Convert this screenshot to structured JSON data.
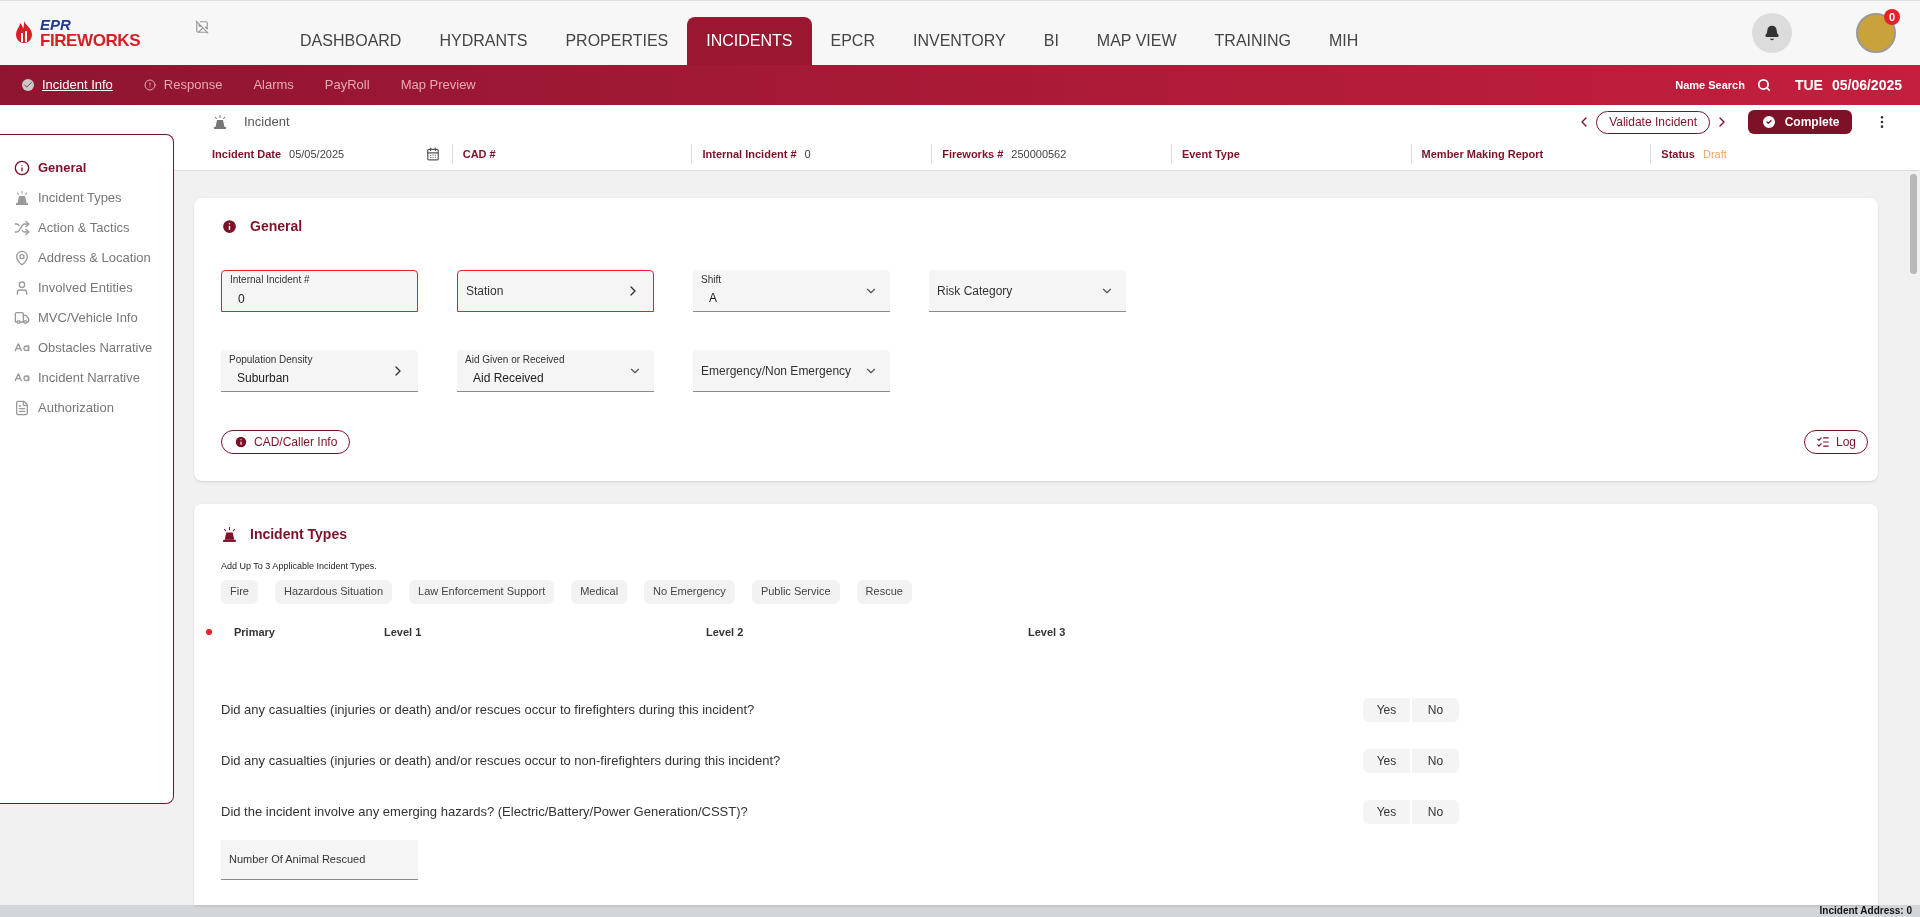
{
  "logo": {
    "top": "EPR",
    "bottom": "FIREWORKS"
  },
  "nav": [
    {
      "label": "DASHBOARD",
      "selected": false
    },
    {
      "label": "HYDRANTS",
      "selected": false
    },
    {
      "label": "PROPERTIES",
      "selected": false
    },
    {
      "label": "INCIDENTS",
      "selected": true
    },
    {
      "label": "EPCR",
      "selected": false
    },
    {
      "label": "INVENTORY",
      "selected": false
    },
    {
      "label": "BI",
      "selected": false
    },
    {
      "label": "MAP VIEW",
      "selected": false
    },
    {
      "label": "TRAINING",
      "selected": false
    },
    {
      "label": "MIH",
      "selected": false
    }
  ],
  "notification_badge": "0",
  "subnav": [
    {
      "label": "Incident Info",
      "selected": true,
      "kind": "check"
    },
    {
      "label": "Response",
      "selected": false,
      "kind": "alert"
    },
    {
      "label": "Alarms",
      "selected": false,
      "kind": "plain"
    },
    {
      "label": "PayRoll",
      "selected": false,
      "kind": "plain"
    },
    {
      "label": "Map Preview",
      "selected": false,
      "kind": "plain"
    }
  ],
  "name_search": "Name Search",
  "date": {
    "day": "TUE",
    "value": "05/06/2025"
  },
  "incident_header": {
    "title": "Incident",
    "validate": "Validate Incident",
    "complete": "Complete",
    "fields": [
      {
        "label": "Incident Date",
        "value": "05/05/2025",
        "kind": "date"
      },
      {
        "label": "CAD #",
        "kind": "text"
      },
      {
        "label": "Internal Incident #",
        "value": "0",
        "kind": "text"
      },
      {
        "label": "Fireworks #",
        "value": "250000562",
        "kind": "text"
      },
      {
        "label": "Event Type",
        "kind": "text"
      },
      {
        "label": "Member Making Report",
        "kind": "text"
      },
      {
        "label": "Status",
        "value": "Draft",
        "kind": "status"
      }
    ]
  },
  "sidebar": [
    {
      "label": "General",
      "selected": true,
      "kind": "info"
    },
    {
      "label": "Incident Types",
      "selected": false,
      "kind": "siren"
    },
    {
      "label": "Action & Tactics",
      "selected": false,
      "kind": "tactics"
    },
    {
      "label": "Address & Location",
      "selected": false,
      "kind": "pin"
    },
    {
      "label": "Involved Entities",
      "selected": false,
      "kind": "person"
    },
    {
      "label": "MVC/Vehicle Info",
      "selected": false,
      "kind": "vehicle"
    },
    {
      "label": "Obstacles Narrative",
      "selected": false,
      "kind": "text"
    },
    {
      "label": "Incident Narrative",
      "selected": false,
      "kind": "text"
    },
    {
      "label": "Authorization",
      "selected": false,
      "kind": "doc"
    }
  ],
  "general": {
    "title": "General",
    "cad_button": "CAD/Caller Info",
    "log_button": "Log",
    "fields": [
      {
        "label": "Internal Incident #",
        "value": "0",
        "kind": "text",
        "error": true
      },
      {
        "label": "Station",
        "kind": "chevron",
        "error": true
      },
      {
        "label": "Shift",
        "value": "A",
        "kind": "dropdown",
        "error": false
      },
      {
        "label": "Risk Category",
        "kind": "dropdown",
        "error": false
      },
      {
        "label": "Population Density",
        "value": "Suburban",
        "kind": "chevron",
        "error": false
      },
      {
        "label": "Aid Given or Received",
        "value": "Aid Received",
        "kind": "dropdown",
        "error": false
      },
      {
        "label": "Emergency/Non Emergency",
        "kind": "dropdown",
        "error": false
      }
    ]
  },
  "incident_types": {
    "title": "Incident Types",
    "hint": "Add Up To 3 Applicable Incident Types.",
    "chips": [
      "Fire",
      "Hazardous Situation",
      "Law Enforcement Support",
      "Medical",
      "No Emergency",
      "Public Service",
      "Rescue"
    ],
    "columns": [
      "Primary",
      "Level 1",
      "Level 2",
      "Level 3"
    ],
    "questions": [
      {
        "text": "Did any casualties (injuries or death) and/or rescues occur to firefighters during this incident?",
        "yes": "Yes",
        "no": "No"
      },
      {
        "text": "Did any casualties (injuries or death) and/or rescues occur to non-firefighters during this incident?",
        "yes": "Yes",
        "no": "No"
      },
      {
        "text": "Did the incident involve any emerging hazards? (Electric/Battery/Power Generation/CSST)?",
        "yes": "Yes",
        "no": "No"
      }
    ],
    "animal_field": "Number Of Animal Rescued"
  },
  "footer": "Incident Address: 0"
}
